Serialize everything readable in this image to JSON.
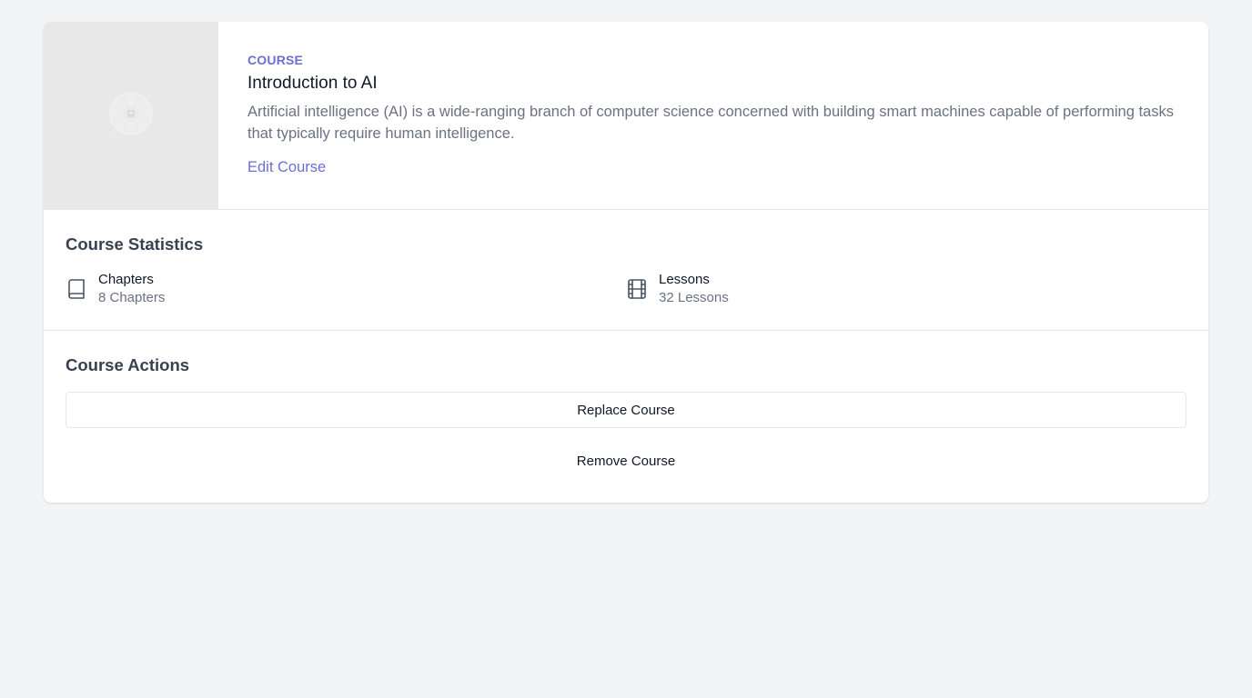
{
  "course": {
    "eyebrow": "COURSE",
    "title": "Introduction to AI",
    "description": "Artificial intelligence (AI) is a wide-ranging branch of computer science concerned with building smart machines capable of performing tasks that typically require human intelligence.",
    "edit_label": "Edit Course",
    "thumbnail_icon": "image-placeholder-icon"
  },
  "statistics": {
    "title": "Course Statistics",
    "items": [
      {
        "label": "Chapters",
        "value": "8 Chapters",
        "icon": "book-icon"
      },
      {
        "label": "Lessons",
        "value": "32 Lessons",
        "icon": "film-icon"
      }
    ]
  },
  "actions": {
    "title": "Course Actions",
    "replace_label": "Replace Course",
    "remove_label": "Remove Course"
  },
  "colors": {
    "accent": "#6b6fd4",
    "background": "#f3f4f6",
    "card": "#ffffff",
    "muted_text": "#6b7280"
  }
}
